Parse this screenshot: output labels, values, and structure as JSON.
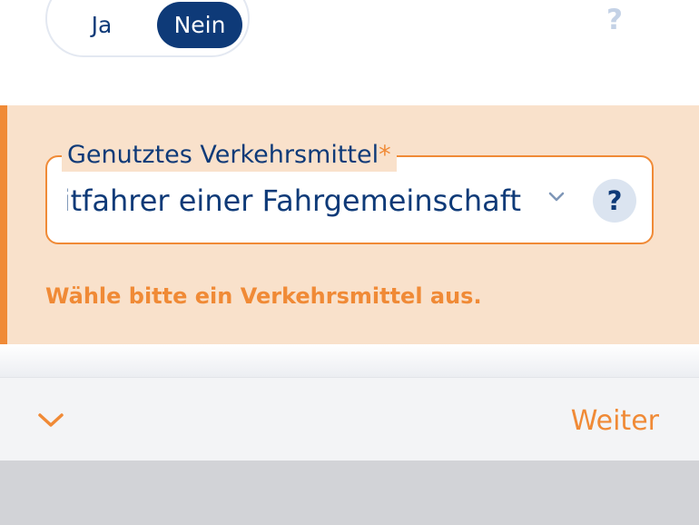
{
  "commute_toggle": {
    "options": [
      "Ja",
      "Nein"
    ],
    "selected": "Nein",
    "help_label": "?"
  },
  "transport_field": {
    "label": "Genutztes Verkehrsmittel",
    "required_marker": "*",
    "value": "Mitfahrer einer Fahrgemeinschaft",
    "help_label": "?",
    "error_message": "Wähle bitte ein Verkehrsmittel aus."
  },
  "footer": {
    "next_label": "Weiter"
  },
  "colors": {
    "primary": "#0e3a78",
    "accent": "#f08a36",
    "error_background": "#f9e1cb"
  },
  "icons": {
    "dropdown": "chevron-down-icon",
    "collapse": "chevron-down-icon"
  }
}
